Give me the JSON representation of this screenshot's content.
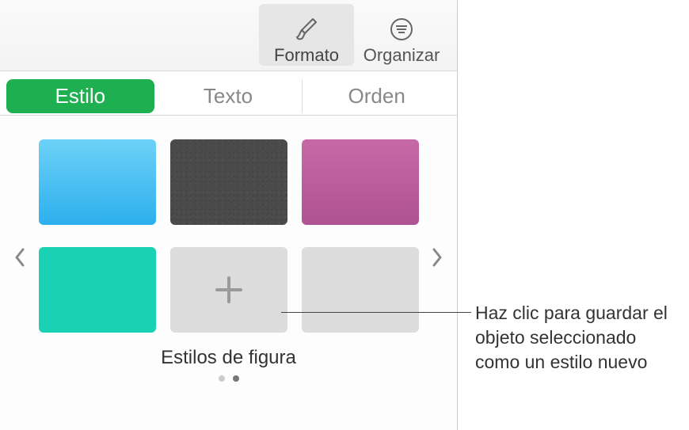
{
  "toolbar": {
    "format": "Formato",
    "organize": "Organizar"
  },
  "tabs": {
    "style": "Estilo",
    "text": "Texto",
    "order": "Orden"
  },
  "styles": {
    "section_title": "Estilos de figura",
    "swatches": [
      {
        "name": "sky-blue"
      },
      {
        "name": "charcoal-texture"
      },
      {
        "name": "magenta"
      },
      {
        "name": "teal"
      },
      {
        "name": "add-new"
      },
      {
        "name": "empty"
      }
    ],
    "add_glyph": "+"
  },
  "callout": {
    "text": "Haz clic para guardar el objeto seleccionado como un estilo nuevo"
  }
}
